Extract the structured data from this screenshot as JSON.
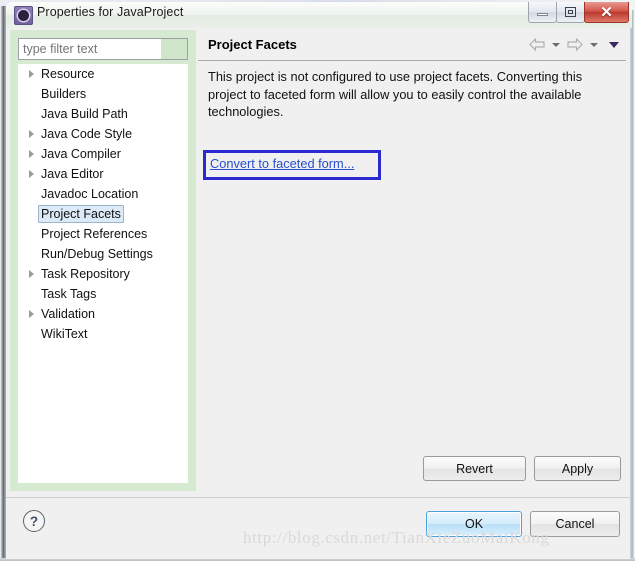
{
  "window": {
    "title": "Properties for JavaProject",
    "icon": "eclipse-gear-icon",
    "controls": {
      "minimize": "–",
      "maximize": "□",
      "close": "✕"
    }
  },
  "sidebar": {
    "filter": {
      "value": "",
      "placeholder": "type filter text"
    },
    "items": [
      {
        "label": "Resource",
        "expandable": true,
        "selected": false
      },
      {
        "label": "Builders",
        "expandable": false,
        "selected": false
      },
      {
        "label": "Java Build Path",
        "expandable": false,
        "selected": false
      },
      {
        "label": "Java Code Style",
        "expandable": true,
        "selected": false
      },
      {
        "label": "Java Compiler",
        "expandable": true,
        "selected": false
      },
      {
        "label": "Java Editor",
        "expandable": true,
        "selected": false
      },
      {
        "label": "Javadoc Location",
        "expandable": false,
        "selected": false
      },
      {
        "label": "Project Facets",
        "expandable": false,
        "selected": true
      },
      {
        "label": "Project References",
        "expandable": false,
        "selected": false
      },
      {
        "label": "Run/Debug Settings",
        "expandable": false,
        "selected": false
      },
      {
        "label": "Task Repository",
        "expandable": true,
        "selected": false
      },
      {
        "label": "Task Tags",
        "expandable": false,
        "selected": false
      },
      {
        "label": "Validation",
        "expandable": true,
        "selected": false
      },
      {
        "label": "WikiText",
        "expandable": false,
        "selected": false
      }
    ]
  },
  "content": {
    "title": "Project Facets",
    "nav": {
      "back": "back-arrow-icon",
      "back_menu": "chevron-down-icon",
      "forward": "forward-arrow-icon",
      "forward_menu": "chevron-down-icon",
      "view_menu": "chevron-down-icon"
    },
    "description": "This project is not configured to use project facets. Converting this project to faceted form will allow you to easily control the available technologies.",
    "link": "Convert to faceted form...",
    "highlight_color": "#2a2ad0",
    "link_color": "#2a4ed0",
    "buttons": {
      "revert": "Revert",
      "apply": "Apply"
    }
  },
  "footer": {
    "help": "?",
    "ok": "OK",
    "cancel": "Cancel"
  },
  "watermark": "http://blog.csdn.net/TianXieZuoMaiKong"
}
